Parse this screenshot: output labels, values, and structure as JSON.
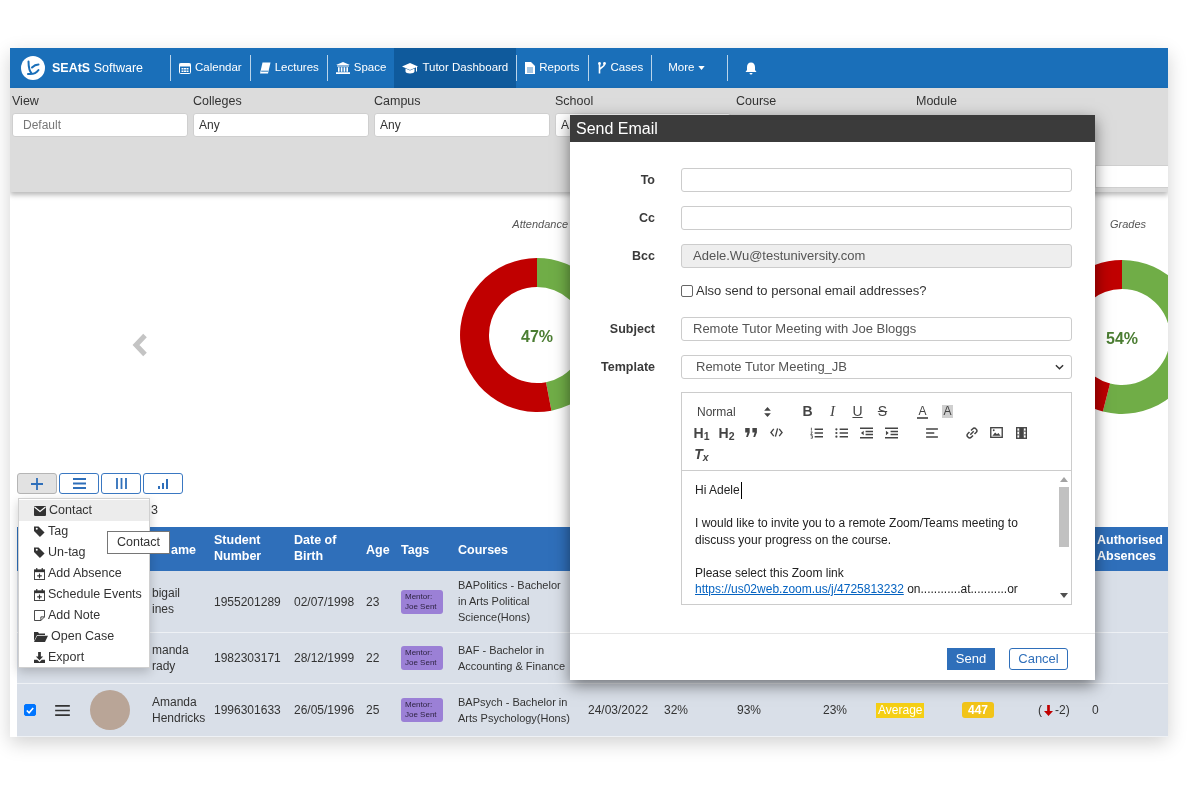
{
  "nav": {
    "brand": "**SEAtS** Software",
    "items": [
      {
        "label": "Calendar",
        "kind": "link",
        "selected": false
      },
      {
        "label": "Lectures",
        "kind": "link",
        "selected": false
      },
      {
        "label": "Space",
        "kind": "link",
        "selected": false
      },
      {
        "label": "Tutor Dashboard",
        "kind": "link",
        "selected": true
      },
      {
        "label": "Reports",
        "kind": "link",
        "selected": false
      },
      {
        "label": "Cases",
        "kind": "link",
        "selected": false
      },
      {
        "label": "More",
        "kind": "dropdown",
        "selected": false
      }
    ]
  },
  "filters": [
    {
      "label": "View",
      "placeholder": "Default"
    },
    {
      "label": "Colleges",
      "value": "Any"
    },
    {
      "label": "Campus",
      "value": "Any"
    },
    {
      "label": "School",
      "value": "A"
    },
    {
      "label": "Course"
    },
    {
      "label": "Module"
    }
  ],
  "charts": [
    {
      "reading": "47%",
      "chart_data": {
        "type": "donut",
        "title": "Attendance",
        "values": [
          47,
          53
        ]
      }
    },
    {
      "reading": "54%",
      "chart_data": {
        "type": "donut",
        "title": "Grades",
        "values": [
          54,
          46
        ]
      }
    }
  ],
  "view_buttons": [
    {
      "selected": true
    },
    {
      "selected": false
    },
    {
      "selected": false
    },
    {
      "selected": false
    }
  ],
  "action_menu": [
    {
      "label": "Contact",
      "selected": true
    },
    {
      "label": "Tag",
      "selected": false
    },
    {
      "label": "Un-tag",
      "selected": false
    },
    {
      "label": "Add Absence",
      "selected": false
    },
    {
      "label": "Schedule Events",
      "selected": false
    },
    {
      "label": "Add Note",
      "selected": false
    },
    {
      "label": "Open Case",
      "selected": false
    },
    {
      "label": "Export",
      "selected": false
    }
  ],
  "tooltip": "Contact",
  "count_text": "3",
  "table": {
    "columns": [
      "ame",
      "Student Number",
      "Date of Birth",
      "Age",
      "Tags",
      "Courses",
      "Authorised Absences"
    ],
    "rows": [
      {
        "name": "bigail ines",
        "student_number": "1955201289",
        "date_of_birth": "02/07/1998",
        "age": "23",
        "tag": "Mentor: Joe Sent",
        "course": "BAPolitics - Bachelor in Arts Political Science(Hons)"
      },
      {
        "name": "manda rady",
        "student_number": "1982303171",
        "date_of_birth": "28/12/1999",
        "age": "22",
        "tag": "Mentor: Joe Sent",
        "course": "BAF - Bachelor in Accounting & Finance"
      },
      {
        "checked": true,
        "name": "Amanda Hendricks",
        "student_number": "1996301633",
        "date_of_birth": "26/05/1996",
        "age": "25",
        "tag": "Mentor: Joe Sent",
        "course": "BAPsych - Bachelor in Arts Psychology(Hons)",
        "column_10": "24/03/2022",
        "column_11": "32%",
        "column_12": "93%",
        "column_13": "23%",
        "column_14": "Average",
        "column_15": "447",
        "column_16": {
          "prefix": "(",
          "falling": true,
          "change": "-2)"
        },
        "authorised_absences": "0"
      }
    ]
  },
  "send_email_dialog": {
    "title": "Send Email",
    "fields": [
      {
        "kind": "input",
        "label": "To",
        "disabled": false
      },
      {
        "kind": "input",
        "label": "Cc",
        "disabled": false
      },
      {
        "kind": "input",
        "label": "Bcc",
        "value": "Adele.Wu@testuniversity.com",
        "disabled": true
      },
      {
        "kind": "checkbox",
        "label": "Also send to personal email addresses?",
        "checked": false,
        "disabled": false
      },
      {
        "kind": "input",
        "label": "Subject",
        "value": "Remote Tutor Meeting with Joe Bloggs",
        "disabled": false
      },
      {
        "kind": "select",
        "label": "Template",
        "value": "Remote Tutor Meeting_JB",
        "disabled": false
      }
    ],
    "editor": {
      "toolbar": [
        [
          {
            "kind": "format_select",
            "label": "Normal"
          }
        ],
        [
          {
            "kind": "bold",
            "label": "B"
          },
          {
            "kind": "italic",
            "label": "I"
          },
          {
            "kind": "underline",
            "label": "U"
          },
          {
            "kind": "strike",
            "label": "S"
          }
        ],
        [
          {
            "kind": "color",
            "label": "A"
          },
          {
            "kind": "background",
            "label": "A"
          }
        ],
        [
          {
            "kind": "header",
            "label": "H$_{1}$"
          },
          {
            "kind": "header",
            "label": "H$_{2}$"
          },
          {
            "kind": "quote"
          },
          {
            "kind": "code"
          }
        ],
        [
          {
            "kind": "ordered_list"
          },
          {
            "kind": "bullet_list"
          },
          {
            "kind": "outdent"
          },
          {
            "kind": "indent"
          }
        ],
        [
          {
            "kind": "align"
          }
        ],
        [
          {
            "kind": "link"
          },
          {
            "kind": "image"
          },
          {
            "kind": "video"
          }
        ],
        [
          {
            "kind": "clean",
            "label": "T$_{x}$"
          }
        ]
      ],
      "paragraphs": [
        {
          "cursor": true,
          "parts": [
            {
              "kind": "text",
              "text": "Hi Adele"
            }
          ]
        },
        {
          "cursor": false,
          "parts": [
            {
              "kind": "text",
              "text": "I would like to invite you to a remote Zoom/Teams meeting to discuss your progress on the course."
            }
          ]
        },
        {
          "cursor": false,
          "parts": [
            {
              "kind": "text",
              "text": "Please select this Zoom link "
            },
            {
              "kind": "link",
              "text": "https://us02web.zoom.us/j/4725813232"
            },
            {
              "kind": "text",
              "text": " on............at...........or"
            }
          ]
        }
      ]
    },
    "buttons": [
      {
        "label": "Send",
        "kind": "primary"
      },
      {
        "label": "Cancel",
        "kind": "secondary"
      }
    ]
  }
}
